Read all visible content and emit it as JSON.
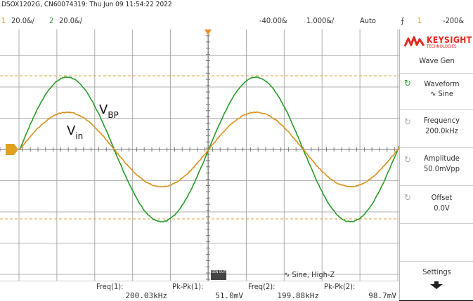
{
  "header": {
    "model_info": "DSOX1202G, CN60074319: Thu Jun 09 11:54:22 2022",
    "ch1_num": "1",
    "ch1_scale": "20.0&/",
    "ch2_num": "2",
    "ch2_scale": "20.0&/",
    "time_delay": "-40.00&",
    "time_scale": "1.000&/",
    "trigger_mode": "Auto",
    "trigger_ch": "1",
    "trigger_level": "-200&"
  },
  "brand": {
    "logo_text": "KEYSIGHT",
    "logo_sub": "TECHNOLOGIES"
  },
  "traces": {
    "vbp_label": "V",
    "vbp_sub": "BP",
    "vin_label": "V",
    "vin_sub": "in"
  },
  "softkeys": {
    "title": "Wave Gen",
    "waveform_label": "Waveform",
    "waveform_value": "Sine",
    "frequency_label": "Frequency",
    "frequency_value": "200.0kHz",
    "amplitude_label": "Amplitude",
    "amplitude_value": "50.0mVpp",
    "offset_label": "Offset",
    "offset_value": "0.0V",
    "settings_label": "Settings"
  },
  "status": {
    "gen_out": "GEN OUT",
    "gen_info": "Sine, High-Z"
  },
  "measurements": [
    {
      "label": "Freq(1):",
      "value": "200.03kHz"
    },
    {
      "label": "Pk-Pk(1):",
      "value": "51.0mV"
    },
    {
      "label": "Freq(2):",
      "value": "199.88kHz"
    },
    {
      "label": "Pk-Pk(2):",
      "value": "98.7mV"
    }
  ],
  "colors": {
    "ch1": "#d8901a",
    "ch2": "#2a9a2a",
    "accent": "#e8261c"
  }
}
